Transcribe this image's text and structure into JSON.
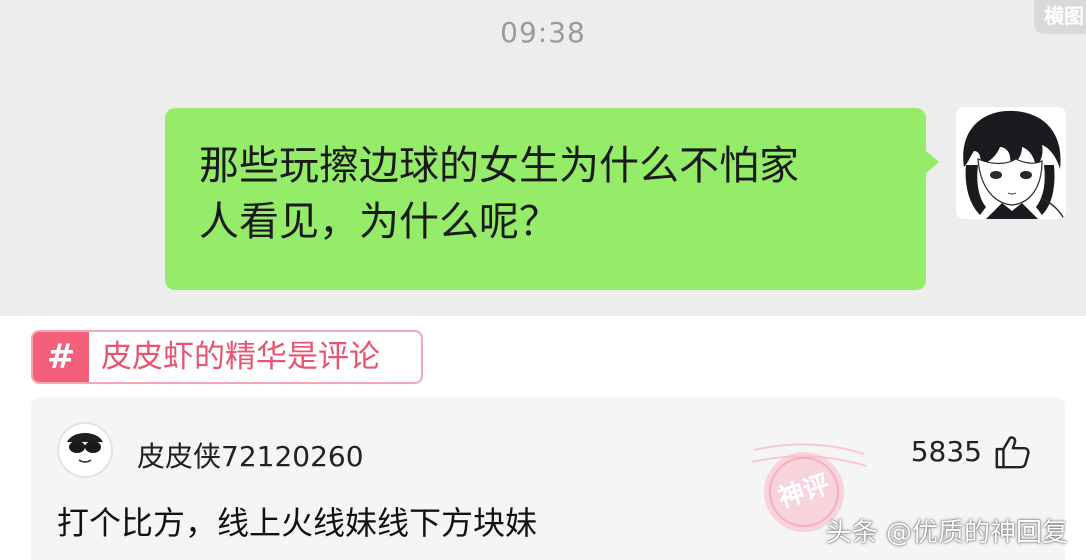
{
  "chat": {
    "timestamp": "09:38",
    "corner_tag": "横图",
    "message_line1": "那些玩擦边球的女生为什么不怕家",
    "message_line2": "人看见，为什么呢？",
    "bubble_color": "#95ec69"
  },
  "topic": {
    "hash": "#",
    "label": "皮皮虾的精华是评论",
    "accent_color": "#f45f7b"
  },
  "comment": {
    "username": "皮皮侠72120260",
    "like_count": "5835",
    "text": "打个比方，线上火线妹线下方块妹",
    "stamp_label": "神评"
  },
  "watermark": "头条 @优质的神回复",
  "icons": {
    "like": "thumbs-up-icon",
    "chat_avatar": "anime-avatar-icon",
    "comment_avatar": "sunglasses-face-icon"
  }
}
